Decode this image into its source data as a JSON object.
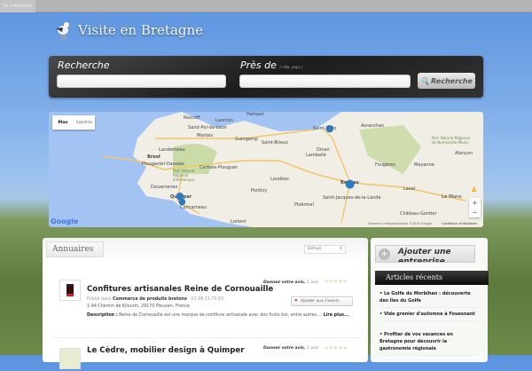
{
  "topbar": {
    "login": "Se connecter"
  },
  "logo": {
    "text": "Visite en Bretagne"
  },
  "search": {
    "label_what": "Recherche",
    "label_where": "Près de",
    "where_hint": "( ville, pays )",
    "what_value": "",
    "where_value": "",
    "button": "Recherche"
  },
  "map": {
    "type_plan": "Plan",
    "type_satellite": "Satellite",
    "attribution": "Données cartographiques ©2016 Google",
    "terms": "Conditions d'utilisation",
    "google": "Google",
    "places": [
      "Roscoff",
      "Lannion",
      "Paimpol",
      "Saint-Pol-de-Léon",
      "Morlaix",
      "Guingamp",
      "Saint-Brieuc",
      "Landerneau",
      "Brest",
      "Plougastel-Daoulas",
      "Carhaix-Plouguer",
      "Parc Naturel Régional d'Armorique",
      "Loudéac",
      "Lamballe",
      "Douarnenez",
      "Quimper",
      "Concarneau",
      "Pontivy",
      "Lorient",
      "Saint-Malo",
      "Dinan",
      "Avranches",
      "Fougères",
      "Mayenne",
      "Rennes",
      "Saint-Jacques-de-la-Lande",
      "Ploërmel",
      "Laval",
      "Château-Gontier",
      "Alençon",
      "Parc Naturel Régional de Normandie-Maine",
      "Le Mans"
    ],
    "zoom_in": "+",
    "zoom_out": "−"
  },
  "main": {
    "tab": "Annuaires",
    "sort": "Défaut",
    "listings": [
      {
        "title": "Confitures artisanales Reine de Cornouaille",
        "avis_label": "Donnez votre avis,",
        "avis_count": "1 avis",
        "rating": 0,
        "favorite": "Ajouter aux Favoris",
        "published_in": "Publié dans",
        "category": "Commerce de produits bretons",
        "phone": "02.98.51.70.83",
        "address": "1-94 Chemin de Kilourin, 29170 Pleuven, France",
        "desc_label": "Description :",
        "description": "Reine de Cornouaille est une marque de confiture artisanale avec des fruits bio, entre autres,...",
        "more": "Lire plus..."
      },
      {
        "title": "Le Cèdre, mobilier design à Quimper",
        "avis_label": "Donnez votre avis,",
        "avis_count": "1 avis",
        "rating": 0
      }
    ]
  },
  "sidebar": {
    "add_button": "Ajouter une entreprise",
    "articles_title": "Articles récents",
    "articles": [
      "Le Golfe du Morbihan : découverte des îles du Golfe",
      "Vide grenier d'automne à Fouesnant",
      "Profiter de vos vacances en Bretagne pour découvrir la gastronomie régionale"
    ]
  }
}
